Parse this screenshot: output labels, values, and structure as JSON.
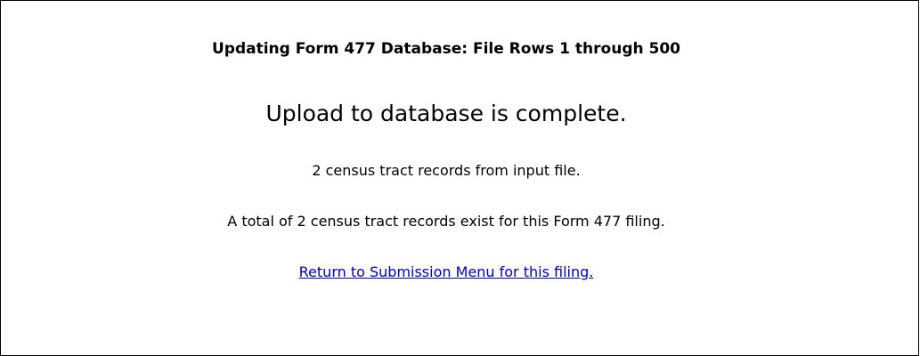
{
  "page": {
    "heading": "Updating Form 477 Database: File Rows 1 through 500",
    "status_message": "Upload to database is complete.",
    "records_from_input": "2 census tract records from input file.",
    "records_total": "A total of 2 census tract records exist for this Form 477 filing.",
    "return_link": "Return to Submission Menu for this filing."
  },
  "colors": {
    "link": "#0000cc",
    "border": "#000000",
    "background": "#ffffff"
  }
}
